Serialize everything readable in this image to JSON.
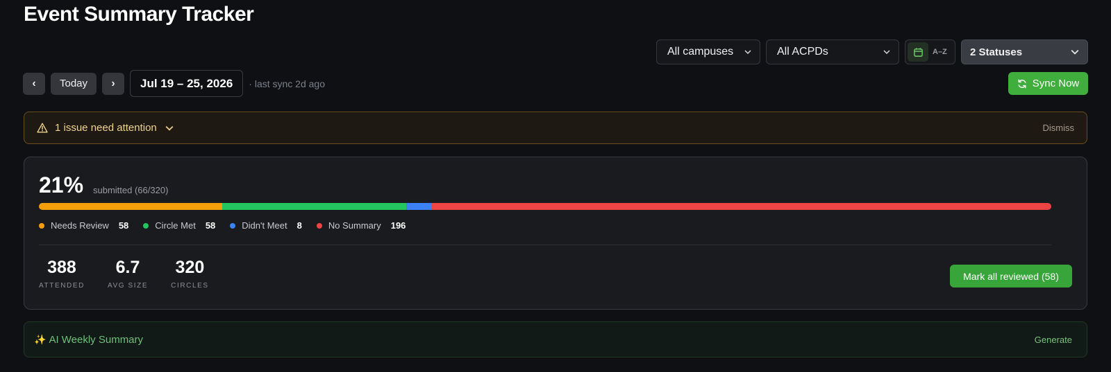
{
  "page": {
    "title": "Event Summary Tracker"
  },
  "filters": {
    "campus": "All campuses",
    "acpd": "All ACPDs",
    "sort_label": "A–Z",
    "status": "2 Statuses"
  },
  "date_nav": {
    "prev_label": "‹",
    "today_label": "Today",
    "next_label": "›",
    "range": "Jul 19 – 25, 2026",
    "last_sync": "· last sync 2d ago",
    "sync_label": "Sync Now"
  },
  "alert": {
    "message": "1 issue need attention",
    "dismiss_label": "Dismiss"
  },
  "summary": {
    "percent": "21%",
    "submitted_text": "submitted (66/320)",
    "segments": [
      {
        "label": "Needs Review",
        "count": 58,
        "color": "#f59e0b"
      },
      {
        "label": "Circle Met",
        "count": 58,
        "color": "#22c55e"
      },
      {
        "label": "Didn't Meet",
        "count": 8,
        "color": "#3b82f6"
      },
      {
        "label": "No Summary",
        "count": 196,
        "color": "#ef4444"
      }
    ],
    "stats": [
      {
        "value": "388",
        "label": "ATTENDED"
      },
      {
        "value": "6.7",
        "label": "AVG SIZE"
      },
      {
        "value": "320",
        "label": "CIRCLES"
      }
    ],
    "mark_reviewed_label": "Mark all reviewed (58)"
  },
  "ai_summary": {
    "title": "AI Weekly Summary",
    "generate_label": "Generate"
  }
}
